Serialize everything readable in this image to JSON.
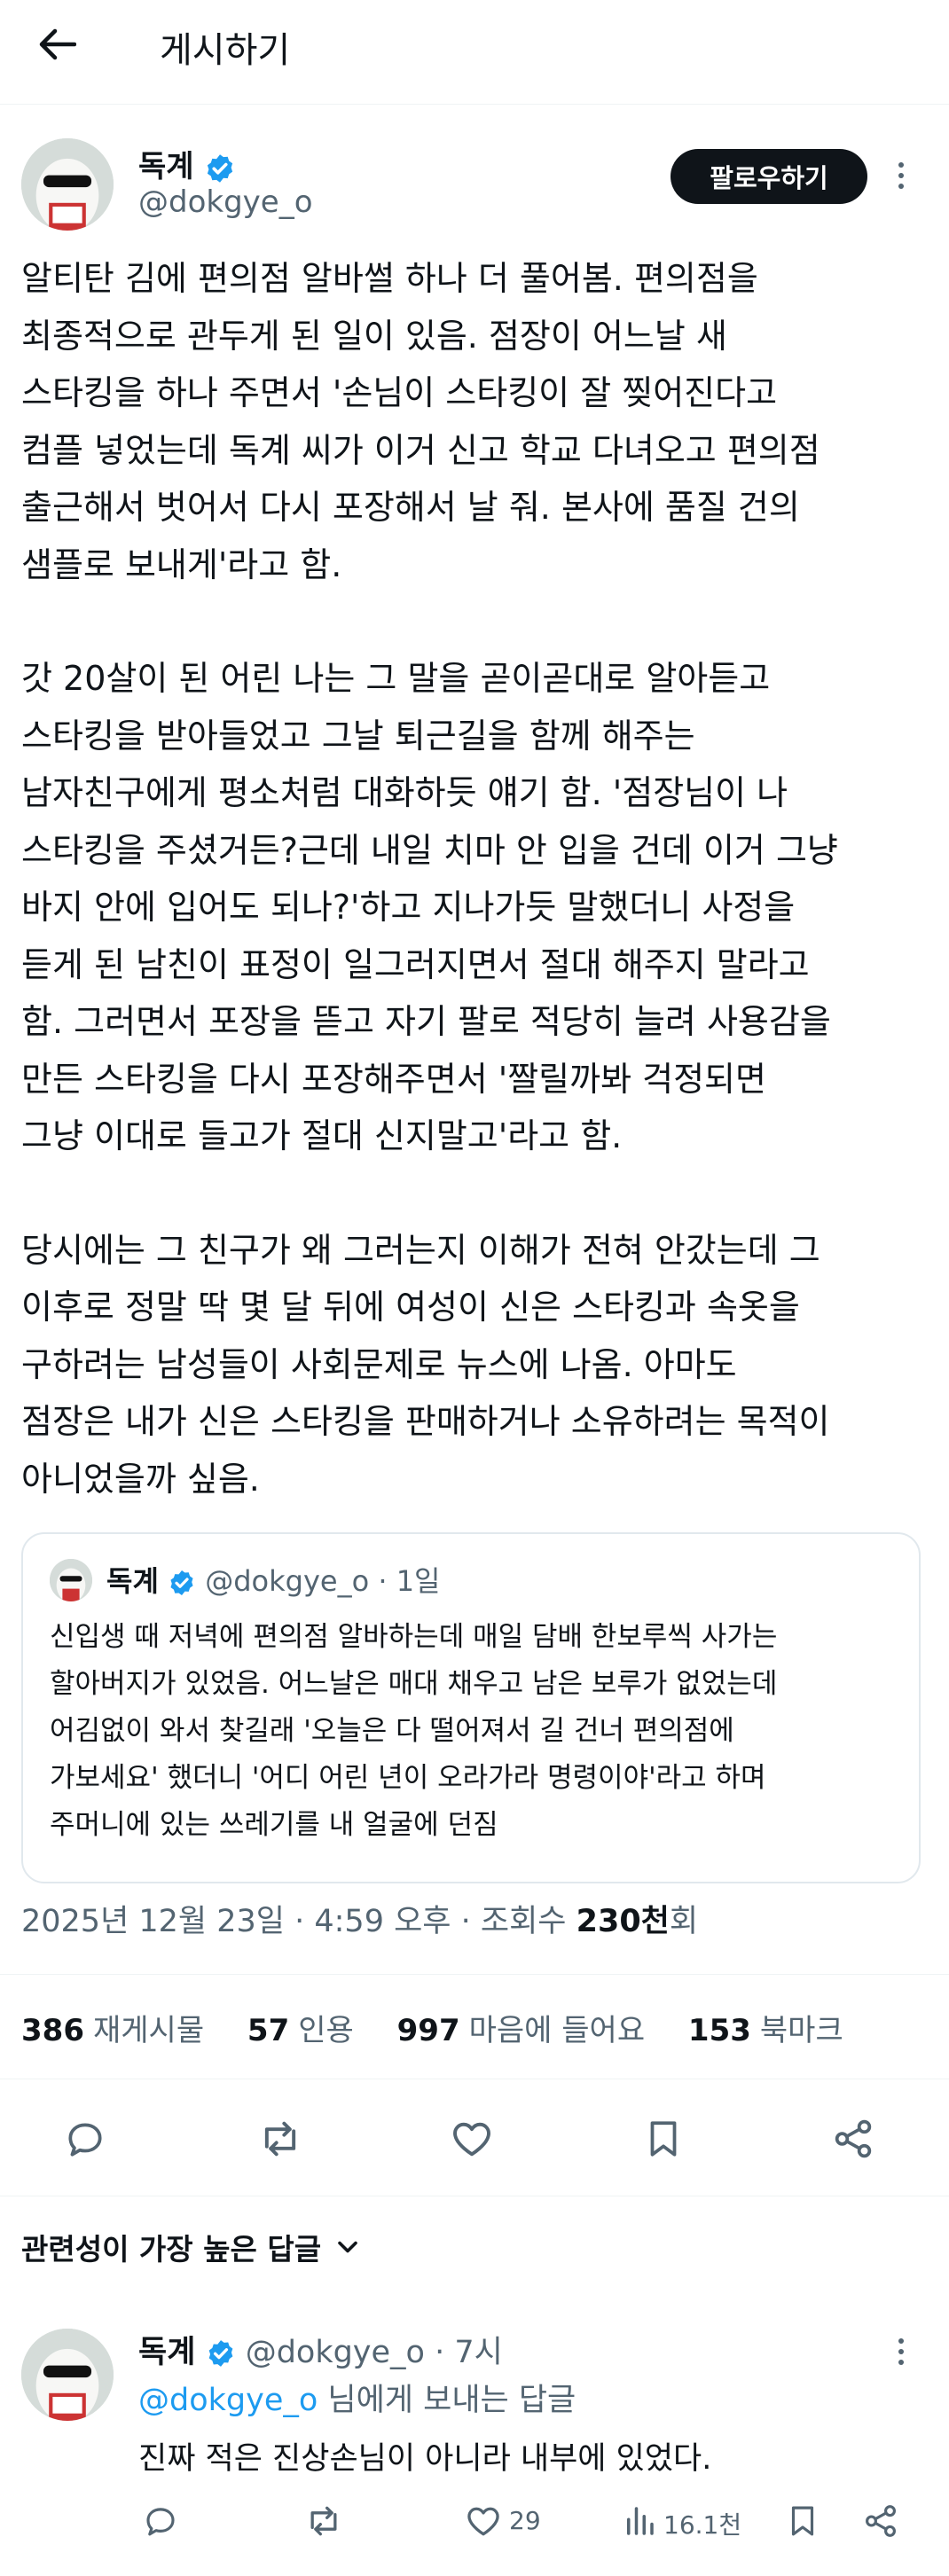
{
  "header": {
    "title": "게시하기"
  },
  "post": {
    "author": {
      "name": "독계",
      "handle": "@dokgye_o"
    },
    "follow_label": "팔로우하기",
    "paragraphs": [
      [
        "알티탄 김에 편의점 알바썰 하나 더 풀어봄. 편의점을",
        "최종적으로 관두게 된 일이 있음. 점장이 어느날 새",
        "스타킹을 하나 주면서 '손님이 스타킹이 잘 찢어진다고",
        "컴플 넣었는데 독계 씨가 이거 신고 학교 다녀오고 편의점",
        "출근해서 벗어서 다시 포장해서 날 줘. 본사에 품질 건의",
        "샘플로 보내게'라고 함."
      ],
      [
        "갓 20살이 된 어린 나는 그 말을 곧이곧대로 알아듣고",
        "스타킹을 받아들었고 그날 퇴근길을 함께 해주는",
        "남자친구에게 평소처럼 대화하듯 얘기 함. '점장님이 나",
        "스타킹을 주셨거든?근데 내일 치마 안 입을 건데 이거 그냥",
        "바지 안에 입어도 되나?'하고 지나가듯 말했더니 사정을",
        "듣게 된 남친이 표정이 일그러지면서 절대 해주지 말라고",
        "함. 그러면서 포장을 뜯고 자기 팔로 적당히 늘려 사용감을",
        "만든 스타킹을 다시 포장해주면서 '짤릴까봐 걱정되면",
        "그냥 이대로 들고가 절대 신지말고'라고 함."
      ],
      [
        "당시에는 그 친구가 왜 그러는지 이해가 전혀 안갔는데 그",
        "이후로 정말 딱 몇 달 뒤에 여성이 신은 스타킹과 속옷을",
        "구하려는 남성들이 사회문제로 뉴스에 나옴. 아마도",
        "점장은 내가 신은 스타킹을 판매하거나 소유하려는 목적이",
        "아니었을까 싶음."
      ]
    ],
    "quote": {
      "name": "독계",
      "handle": "@dokgye_o",
      "time": "· 1일",
      "lines": [
        "신입생 때 저녁에 편의점 알바하는데 매일 담배 한보루씩 사가는",
        "할아버지가 있었음. 어느날은 매대 채우고 남은 보루가 없었는데",
        "어김없이 와서 찾길래 '오늘은 다 떨어져서 길 건너 편의점에",
        "가보세요' 했더니 '어디 어린 년이 오라가라 명령이야'라고 하며",
        "주머니에 있는 쓰레기를 내 얼굴에 던짐"
      ]
    },
    "meta": {
      "date": "2025년 12월 23일 · 4:59 오후 · 조회수 ",
      "views": "230천",
      "views_suffix": "회"
    },
    "stats": {
      "reposts": {
        "num": "386",
        "label": "재게시물"
      },
      "quotes": {
        "num": "57",
        "label": "인용"
      },
      "likes": {
        "num": "997",
        "label": "마음에 들어요"
      },
      "bookmarks": {
        "num": "153",
        "label": "북마크"
      }
    }
  },
  "replies_sort": {
    "label": "관련성이 가장 높은 답글"
  },
  "reply": {
    "name": "독계",
    "handle": "@dokgye_o",
    "time": "· 7시",
    "replying_mention": "@dokgye_o",
    "replying_suffix": " 님에게 보내는 답글",
    "text": "진짜 적은 진상손님이 아니라 내부에 있었다.",
    "likes": "29",
    "views": "16.1천"
  },
  "colors": {
    "accent": "#1d9bf0",
    "text": "#0f1419",
    "muted": "#536471"
  }
}
